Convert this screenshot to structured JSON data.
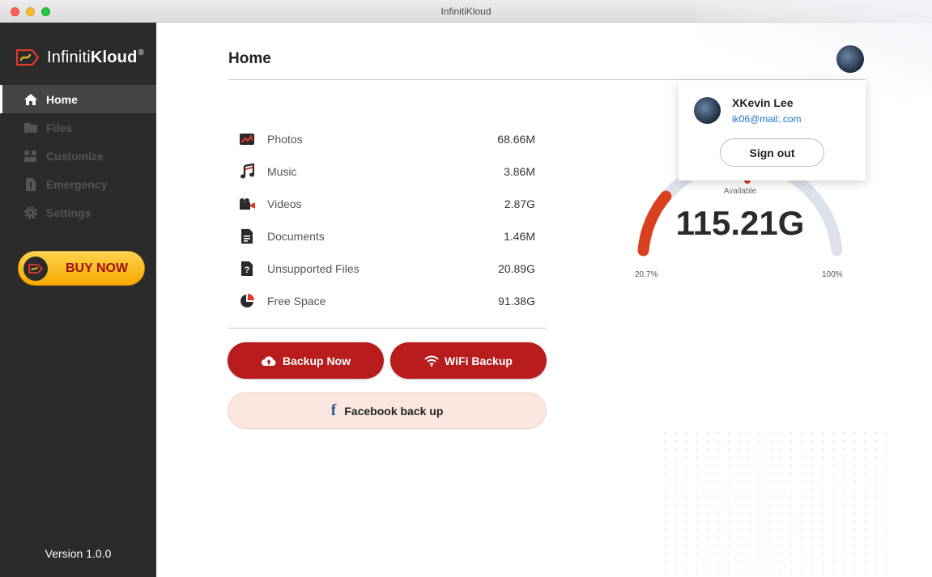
{
  "window": {
    "title": "InfinitiKloud"
  },
  "brand": {
    "name_light": "Infiniti",
    "name_bold": "Kloud",
    "reg": "®"
  },
  "nav": {
    "items": [
      {
        "label": "Home",
        "icon": "home-icon",
        "active": true
      },
      {
        "label": "Files",
        "icon": "folder-icon",
        "active": false
      },
      {
        "label": "Customize",
        "icon": "customize-icon",
        "active": false
      },
      {
        "label": "Emergency",
        "icon": "emergency-icon",
        "active": false
      },
      {
        "label": "Settings",
        "icon": "gear-icon",
        "active": false
      }
    ]
  },
  "buy_now": {
    "label": "BUY NOW"
  },
  "version": "Version 1.0.0",
  "page": {
    "title": "Home"
  },
  "storage": [
    {
      "label": "Photos",
      "value": "68.66M",
      "icon": "photo-icon"
    },
    {
      "label": "Music",
      "value": "3.86M",
      "icon": "music-icon"
    },
    {
      "label": "Videos",
      "value": "2.87G",
      "icon": "video-icon"
    },
    {
      "label": "Documents",
      "value": "1.46M",
      "icon": "document-icon"
    },
    {
      "label": "Unsupported Files",
      "value": "20.89G",
      "icon": "unsupported-file-icon"
    },
    {
      "label": "Free Space",
      "value": "91.38G",
      "icon": "pie-icon"
    }
  ],
  "actions": {
    "backup_now": "Backup Now",
    "wifi_backup": "WiFi Backup",
    "facebook_backup": "Facebook back up",
    "facebook_glyph": "f"
  },
  "gauge": {
    "available_label": "Available",
    "value": "115.21G",
    "min_label": "20.7%",
    "max_label": "100%",
    "used_fraction": 0.207,
    "colors": {
      "used": "#d9411e",
      "track": "#dde1ec"
    }
  },
  "account": {
    "name": "XKevin Lee",
    "email": "ik06@mail:.com",
    "sign_out": "Sign out"
  },
  "colors": {
    "accent_red": "#b81c1c",
    "sidebar": "#2b2b2b",
    "buy_yellow": "#f5a800"
  }
}
